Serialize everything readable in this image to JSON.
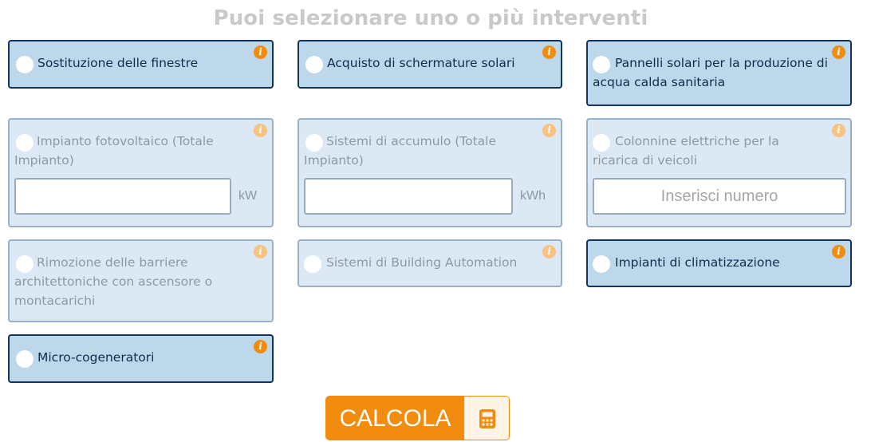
{
  "heading": "Puoi selezionare uno o più interventi",
  "cards": [
    {
      "label": "Sostituzione delle finestre",
      "state": "active"
    },
    {
      "label": "Acquisto di schermature solari",
      "state": "active"
    },
    {
      "label": "Pannelli solari per la produzione di acqua calda sanitaria",
      "state": "active"
    },
    {
      "label": "Impianto fotovoltaico (Totale Impianto)",
      "state": "disabled",
      "unit": "kW",
      "value": ""
    },
    {
      "label": "Sistemi di accumulo (Totale Impianto)",
      "state": "disabled",
      "unit": "kWh",
      "value": ""
    },
    {
      "label": "Colonnine elettriche per la ricarica di veicoli",
      "state": "disabled",
      "placeholder": "Inserisci numero"
    },
    {
      "label": "Rimozione delle barriere architettoniche con ascensore o montacarichi",
      "state": "disabled"
    },
    {
      "label": "Sistemi di Building Automation",
      "state": "disabled"
    },
    {
      "label": "Impianti di climatizzazione",
      "state": "active"
    },
    {
      "label": "Micro-cogeneratori",
      "state": "active"
    }
  ],
  "info_glyph": "i",
  "info_icon": "info-icon",
  "calculate": {
    "label": "CALCOLA",
    "icon": "calculator-icon"
  },
  "colors": {
    "active_bg": "#bdd8eb",
    "active_border": "#11355a",
    "disabled_bg": "#dce9f4",
    "accent": "#f28c0f"
  }
}
